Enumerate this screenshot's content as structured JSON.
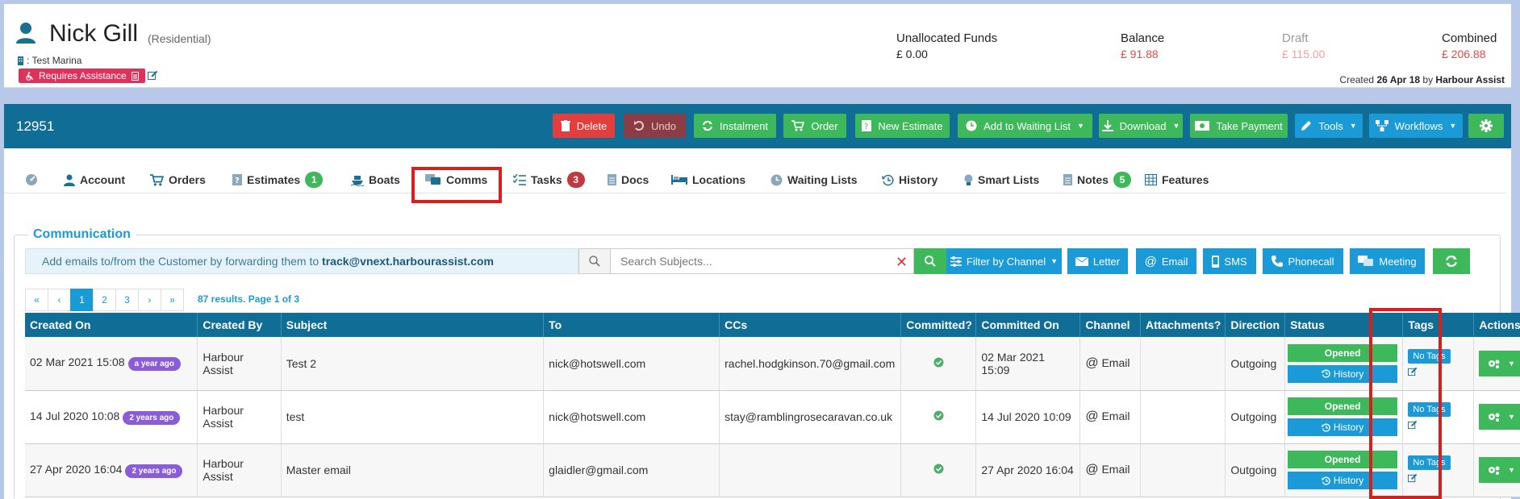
{
  "customer": {
    "name": "Nick Gill",
    "type": "(Residential)",
    "marina": ": Test Marina",
    "assist_label": "Requires Assistance"
  },
  "finances": {
    "unallocated_label": "Unallocated Funds",
    "unallocated_value": "£ 0.00",
    "balance_label": "Balance",
    "balance_value": "£ 91.88",
    "draft_label": "Draft",
    "draft_value": "£ 115.00",
    "combined_label": "Combined",
    "combined_value": "£ 206.88"
  },
  "created": {
    "prefix": "Created",
    "date": "26 Apr 18",
    "by": "by",
    "author": "Harbour Assist"
  },
  "account_id": "12951",
  "toolbar": {
    "delete": "Delete",
    "undo": "Undo",
    "instalment": "Instalment",
    "order": "Order",
    "new_estimate": "New Estimate",
    "waiting_list": "Add to Waiting List",
    "download": "Download",
    "take_payment": "Take Payment",
    "tools": "Tools",
    "workflows": "Workflows"
  },
  "tabs": [
    {
      "label": "Account"
    },
    {
      "label": "Orders"
    },
    {
      "label": "Estimates",
      "badge": "1"
    },
    {
      "label": "Boats"
    },
    {
      "label": "Comms"
    },
    {
      "label": "Tasks",
      "badge": "3"
    },
    {
      "label": "Docs"
    },
    {
      "label": "Locations"
    },
    {
      "label": "Waiting Lists"
    },
    {
      "label": "History"
    },
    {
      "label": "Smart Lists"
    },
    {
      "label": "Notes",
      "badge": "5"
    },
    {
      "label": "Features"
    }
  ],
  "communication": {
    "title": "Communication",
    "info_text": "Add emails to/from the Customer by forwarding them to ",
    "info_email": "track@vnext.harbourassist.com",
    "search_placeholder": "Search Subjects...",
    "filter_label": "Filter by Channel",
    "channels": [
      "Letter",
      "Email",
      "SMS",
      "Phonecall",
      "Meeting"
    ]
  },
  "pager": {
    "pages": [
      "«",
      "‹",
      "1",
      "2",
      "3",
      "›",
      "»"
    ],
    "active": "1",
    "results": "87 results. Page 1 of 3"
  },
  "table": {
    "headers": [
      "Created On",
      "Created By",
      "Subject",
      "To",
      "CCs",
      "Committed?",
      "Committed On",
      "Channel",
      "Attachments?",
      "Direction",
      "Status",
      "Tags",
      "Actions"
    ],
    "rows": [
      {
        "created_on": "02 Mar 2021 15:08",
        "ago": "a year ago",
        "created_by": "Harbour Assist",
        "subject": "Test 2",
        "to": "nick@hotswell.com",
        "ccs": "rachel.hodgkinson.70@gmail.com",
        "committed_on": "02 Mar 2021 15:09",
        "channel": "Email",
        "direction": "Outgoing",
        "status": "Opened",
        "history": "History",
        "tags": "No Tags"
      },
      {
        "created_on": "14 Jul 2020 10:08",
        "ago": "2 years ago",
        "created_by": "Harbour Assist",
        "subject": "test",
        "to": "nick@hotswell.com",
        "ccs": "stay@ramblingrosecaravan.co.uk",
        "committed_on": "14 Jul 2020 10:09",
        "channel": "Email",
        "direction": "Outgoing",
        "status": "Opened",
        "history": "History",
        "tags": "No Tags"
      },
      {
        "created_on": "27 Apr 2020 16:04",
        "ago": "2 years ago",
        "created_by": "Harbour Assist",
        "subject": "Master email",
        "to": "glaidler@gmail.com",
        "ccs": "",
        "committed_on": "27 Apr 2020 16:04",
        "channel": "Email",
        "direction": "Outgoing",
        "status": "Opened",
        "history": "History",
        "tags": "No Tags"
      }
    ]
  },
  "colors": {
    "accent": "#1a9ad6",
    "bar": "#0f6d96",
    "green": "#3db85a",
    "red": "#e43d3d",
    "highlight": "#d62020",
    "balance": "#e54848",
    "draft": "#f0a0a0"
  }
}
